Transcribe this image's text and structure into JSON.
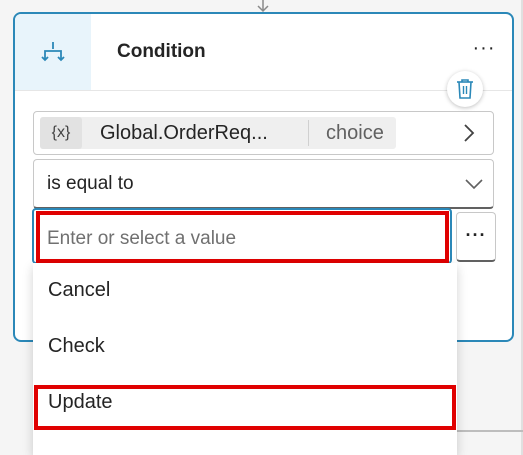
{
  "card": {
    "title": "Condition",
    "more_label": "···",
    "icon": "branch-icon",
    "delete_icon": "trash-icon"
  },
  "condition": {
    "variable_icon_label": "{x}",
    "variable_name": "Global.OrderReq...",
    "variable_type": "choice",
    "operator": "is equal to",
    "value_placeholder": "Enter or select a value",
    "value_more_label": "···"
  },
  "options": [
    {
      "label": "Cancel"
    },
    {
      "label": "Check"
    },
    {
      "label": "Update"
    }
  ],
  "colors": {
    "accent": "#2b88b8",
    "highlight": "#e00000",
    "icon_bg": "#e8f4fb"
  }
}
